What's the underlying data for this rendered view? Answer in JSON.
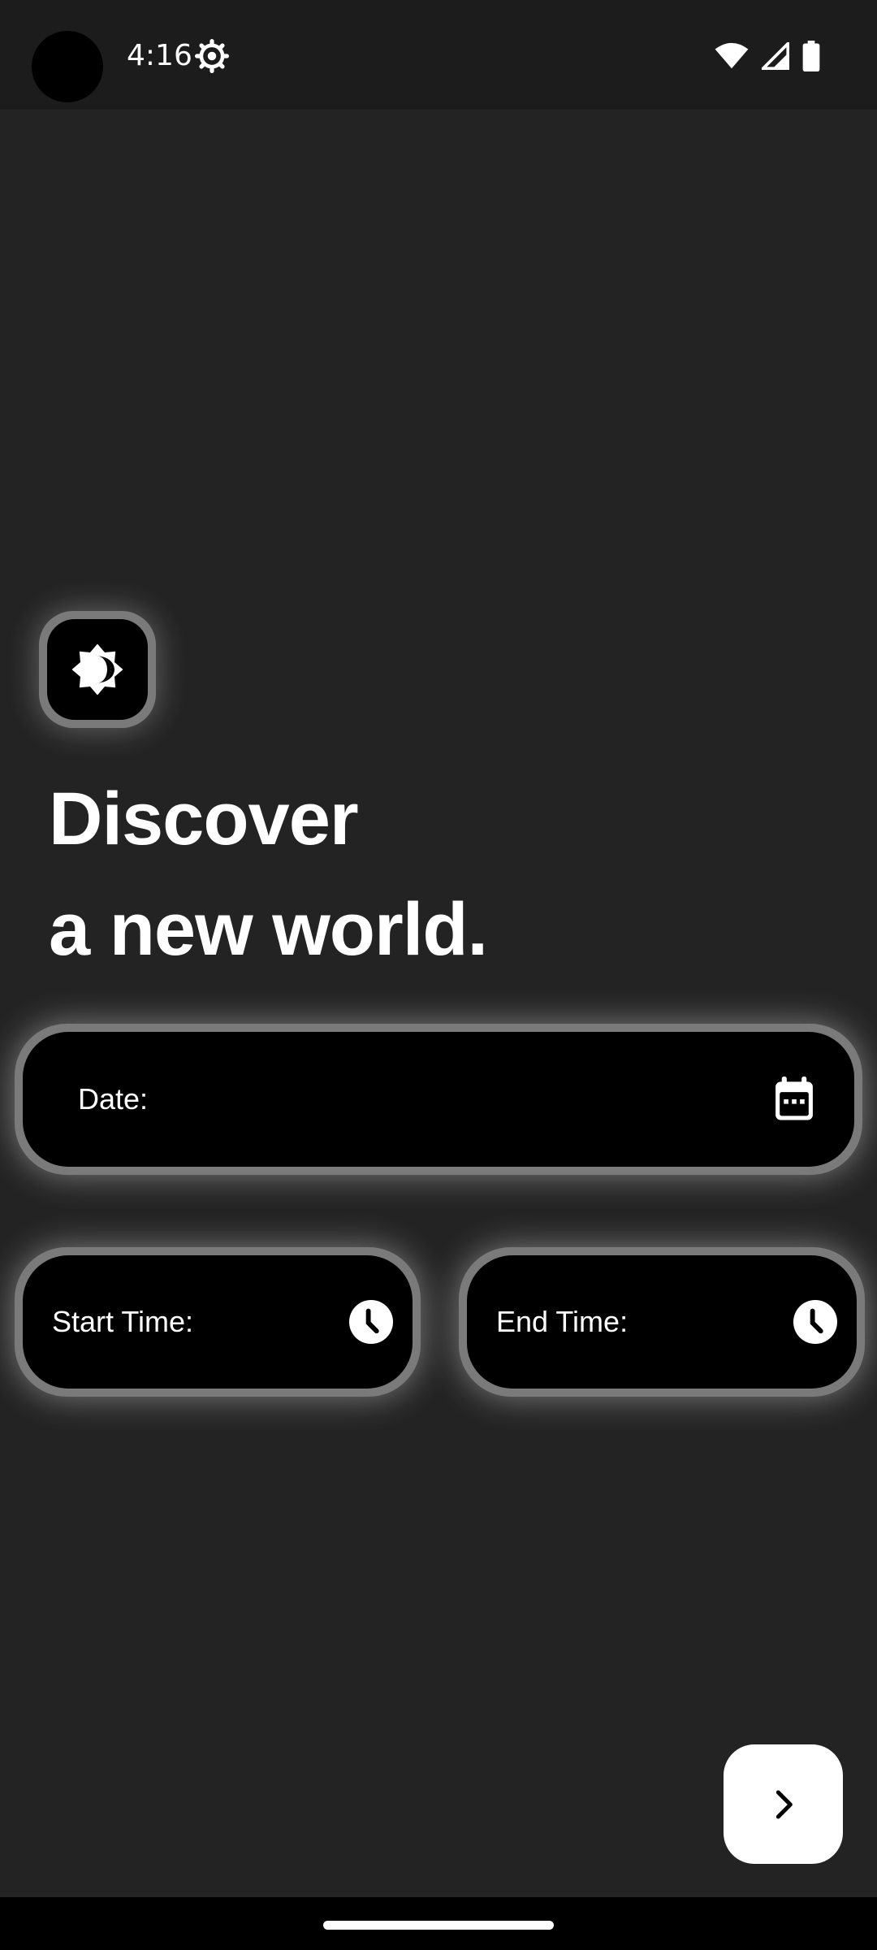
{
  "status_bar": {
    "time": "4:16",
    "icons": [
      "camera-cutout",
      "settings-gear-icon",
      "wifi-icon",
      "cell-signal-icon",
      "battery-icon"
    ]
  },
  "theme_toggle": {
    "icon": "brightness-icon"
  },
  "headline": {
    "line1": "Discover",
    "line2": "a new world."
  },
  "form": {
    "date_label": "Date:",
    "date_icon": "calendar-icon",
    "start_label": "Start Time:",
    "start_icon": "clock-icon",
    "end_label": "End Time:",
    "end_icon": "clock-icon"
  },
  "next_button": {
    "icon": "chevron-right-icon"
  },
  "colors": {
    "background": "#232323",
    "field_fill": "#000000",
    "field_border": "#7a7a7a",
    "text": "#ffffff"
  }
}
